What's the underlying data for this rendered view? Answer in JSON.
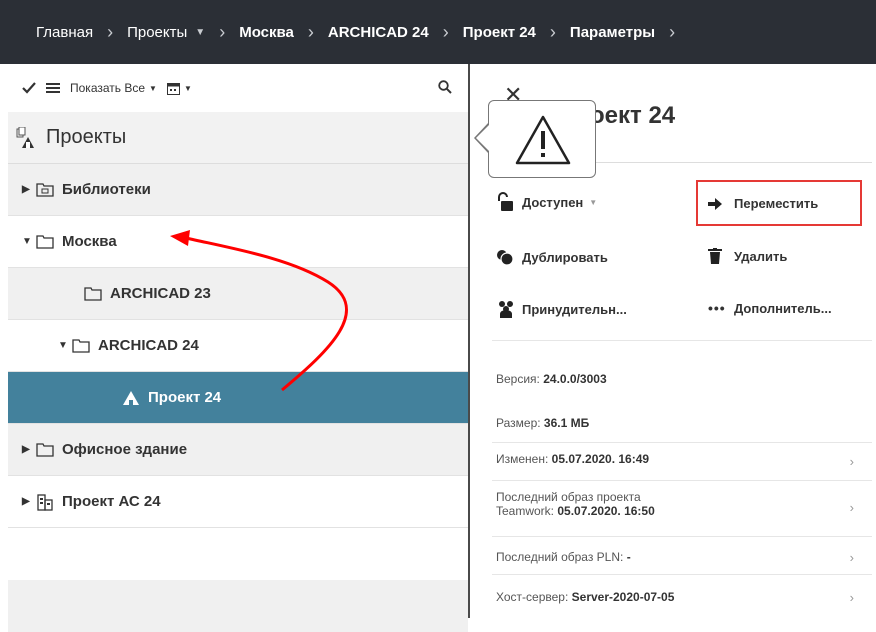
{
  "breadcrumb": {
    "home": "Главная",
    "projects": "Проекты",
    "moscow": "Москва",
    "archicad": "ARCHICAD 24",
    "project": "Проект 24",
    "params": "Параметры"
  },
  "toolbar": {
    "show_all": "Показать Все"
  },
  "tree": {
    "header": "Проекты",
    "items": [
      {
        "label": "Библиотеки"
      },
      {
        "label": "Москва"
      },
      {
        "label": "ARCHICAD 23"
      },
      {
        "label": "ARCHICAD 24"
      },
      {
        "label": "Проект 24"
      },
      {
        "label": "Офисное здание"
      },
      {
        "label": "Проект АС 24"
      }
    ]
  },
  "details": {
    "title": "оект 24",
    "actions": {
      "available": "Доступен",
      "move": "Переместить",
      "duplicate": "Дублировать",
      "delete": "Удалить",
      "force": "Принудительн...",
      "more": "Дополнитель..."
    },
    "info": {
      "version_label": "Версия: ",
      "version_value": "24.0.0/3003",
      "size_label": "Размер: ",
      "size_value": "36.1 МБ",
      "modified_label": "Изменен: ",
      "modified_value": "05.07.2020. 16:49",
      "last_image_label_1": "Последний образ проекта",
      "last_image_label_2": "Teamwork: ",
      "last_image_value": "05.07.2020. 16:50",
      "last_pln_label": "Последний образ PLN: ",
      "last_pln_value": "-",
      "host_label": "Хост-сервер: ",
      "host_value": "Server-2020-07-05"
    }
  },
  "colors": {
    "topbar": "#2b2f36",
    "selected_row": "#43819c",
    "highlight": "#e53935",
    "arrow": "#ff0000"
  }
}
